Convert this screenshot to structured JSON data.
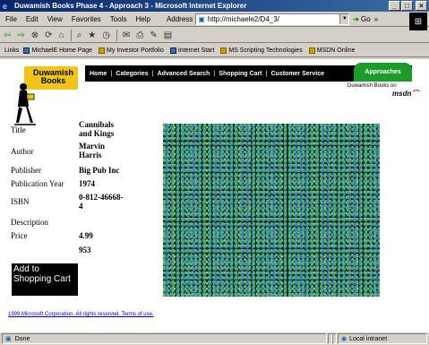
{
  "window": {
    "title": "Duwamish Books Phase 4 - Approach 3 - Microsoft Internet Explorer",
    "controls": [
      "_",
      "□",
      "×"
    ]
  },
  "menubar": {
    "items": [
      "File",
      "Edit",
      "View",
      "Favorites",
      "Tools",
      "Help"
    ],
    "address_label": "Address",
    "address_value": "http://michaele2/D4_3/",
    "go_label": "Go",
    "links_chevron": "»"
  },
  "toolbar": {
    "icons": [
      "back-icon",
      "forward-icon",
      "stop-icon",
      "refresh-icon",
      "home-icon",
      "search-icon",
      "favorites-icon",
      "history-icon",
      "mail-icon",
      "print-icon",
      "edit-icon",
      "discuss-icon"
    ]
  },
  "linksbar": {
    "label": "Links",
    "items": [
      "MichaelE Home Page",
      "My Investor Portfolio",
      "Internet Start",
      "MS Scripting Technologies",
      "MSDN Online"
    ]
  },
  "site": {
    "logo_line1": "Duwamish",
    "logo_line2": "Books",
    "nav": [
      "Home",
      "Categories",
      "Advanced Search",
      "Shopping Cart",
      "Customer Service"
    ],
    "approaches": "Approaches",
    "msdn_tag": "Duwamish Books on",
    "msdn_logo": "msdn"
  },
  "book": {
    "title_label": "Title",
    "title_value_line1": "Cannibals",
    "title_value_line2": "and Kings",
    "author_label": "Author",
    "author_value_line1": "Marvin",
    "author_value_line2": "Harris",
    "publisher_label": "Publisher",
    "publisher_value": "Big Pub Inc",
    "pubyear_label": "Publication Year",
    "pubyear_value": "1974",
    "isbn_label": "ISBN",
    "isbn_value_line1": "0-812-46668-",
    "isbn_value_line2": "4",
    "description_label": "Description",
    "price_label": "Price",
    "price_value": "4.99",
    "extra_value": "953",
    "add_to_cart": "Add to Shopping Cart"
  },
  "footer": {
    "text": "1999 Microsoft Corporation. All rights reserved. Terms of use."
  },
  "statusbar": {
    "status": "Done",
    "zone": "Local intranet"
  }
}
